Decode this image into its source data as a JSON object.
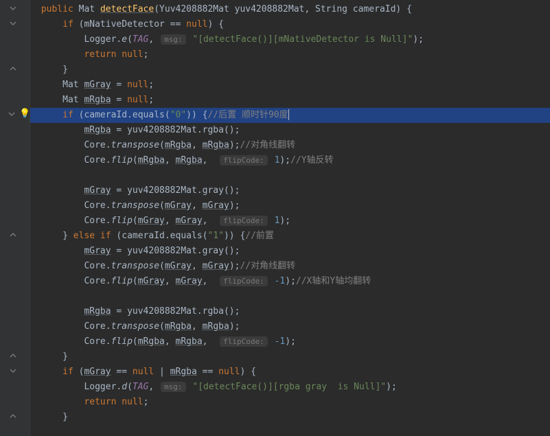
{
  "gutter": {
    "fold_open": "▾",
    "fold_close": "▴",
    "bulb": "💡"
  },
  "hints": {
    "msg": "msg:",
    "flipCode": "flipCode:"
  },
  "code": {
    "l1_kw1": "public",
    "l1_type1": " Mat ",
    "l1_method": "detectFace",
    "l1_params": "(Yuv4208882Mat yuv4208882Mat, String cameraId) {",
    "l2_if": "if",
    "l2_cond": " (mNativeDetector == ",
    "l2_null": "null",
    "l2_end": ") {",
    "l3_logger": "Logger.",
    "l3_e": "e",
    "l3_open": "(",
    "l3_tag": "TAG",
    "l3_comma": ", ",
    "l3_str": "\"[detectFace()][mNativeDetector is Null]\"",
    "l3_close": ");",
    "l4_return": "return",
    "l4_null": " null",
    "l4_semi": ";",
    "l5_brace": "}",
    "l6_mat": "Mat ",
    "l6_var": "mGray",
    "l6_eq": " = ",
    "l6_null": "null",
    "l6_semi": ";",
    "l7_mat": "Mat ",
    "l7_var": "mRgba",
    "l7_eq": " = ",
    "l7_null": "null",
    "l7_semi": ";",
    "l8_if": "if",
    "l8_cond": " (cameraId.equals(",
    "l8_str": "\"0\"",
    "l8_close": ")) {",
    "l8_comment": "//后置 顺时针90度",
    "l9_var": "mRgba",
    "l9_eq": " = yuv4208882Mat.rgba();",
    "l10_core": "Core.",
    "l10_trans": "transpose",
    "l10_open": "(",
    "l10_a1": "mRgba",
    "l10_c": ", ",
    "l10_a2": "mRgba",
    "l10_close": ");",
    "l10_comment": "//对角线翻转",
    "l11_core": "Core.",
    "l11_flip": "flip",
    "l11_open": "(",
    "l11_a1": "mRgba",
    "l11_c1": ", ",
    "l11_a2": "mRgba",
    "l11_c2": ",  ",
    "l11_num": "1",
    "l11_close": ");",
    "l11_comment": "//Y轴反转",
    "l12_var": "mGray",
    "l12_rest": " = yuv4208882Mat.gray();",
    "l13_core": "Core.",
    "l13_trans": "transpose",
    "l13_open": "(",
    "l13_a1": "mGray",
    "l13_c": ", ",
    "l13_a2": "mGray",
    "l13_close": ");",
    "l14_core": "Core.",
    "l14_flip": "flip",
    "l14_open": "(",
    "l14_a1": "mGray",
    "l14_c1": ", ",
    "l14_a2": "mGray",
    "l14_c2": ",  ",
    "l14_num": "1",
    "l14_close": ");",
    "l15_brace": "} ",
    "l15_else": "else if",
    "l15_cond": " (cameraId.equals(",
    "l15_str": "\"1\"",
    "l15_close": ")) {",
    "l15_comment": "//前置",
    "l16_var": "mGray",
    "l16_rest": " = yuv4208882Mat.gray();",
    "l17_core": "Core.",
    "l17_trans": "transpose",
    "l17_open": "(",
    "l17_a1": "mGray",
    "l17_c": ", ",
    "l17_a2": "mGray",
    "l17_close": ");",
    "l17_comment": "//对角线翻转",
    "l18_core": "Core.",
    "l18_flip": "flip",
    "l18_open": "(",
    "l18_a1": "mGray",
    "l18_c1": ", ",
    "l18_a2": "mGray",
    "l18_c2": ",  ",
    "l18_num": "-1",
    "l18_close": ");",
    "l18_comment": "//X轴和Y轴均翻转",
    "l19_var": "mRgba",
    "l19_rest": " = yuv4208882Mat.rgba();",
    "l20_core": "Core.",
    "l20_trans": "transpose",
    "l20_open": "(",
    "l20_a1": "mRgba",
    "l20_c": ", ",
    "l20_a2": "mRgba",
    "l20_close": ");",
    "l21_core": "Core.",
    "l21_flip": "flip",
    "l21_open": "(",
    "l21_a1": "mRgba",
    "l21_c1": ", ",
    "l21_a2": "mRgba",
    "l21_c2": ",  ",
    "l21_num": "-1",
    "l21_close": ");",
    "l22_brace": "}",
    "l23_if": "if",
    "l23_open": " (",
    "l23_v1": "mGray",
    "l23_mid": " == ",
    "l23_null1": "null",
    "l23_or": " | ",
    "l23_v2": "mRgba",
    "l23_mid2": " == ",
    "l23_null2": "null",
    "l23_close": ") {",
    "l24_logger": "Logger.",
    "l24_d": "d",
    "l24_open": "(",
    "l24_tag": "TAG",
    "l24_c": ", ",
    "l24_str": "\"[detectFace()][rgba gray  is Null]\"",
    "l24_close": ");",
    "l25_return": "return",
    "l25_null": " null",
    "l25_semi": ";",
    "l26_brace": "}"
  }
}
